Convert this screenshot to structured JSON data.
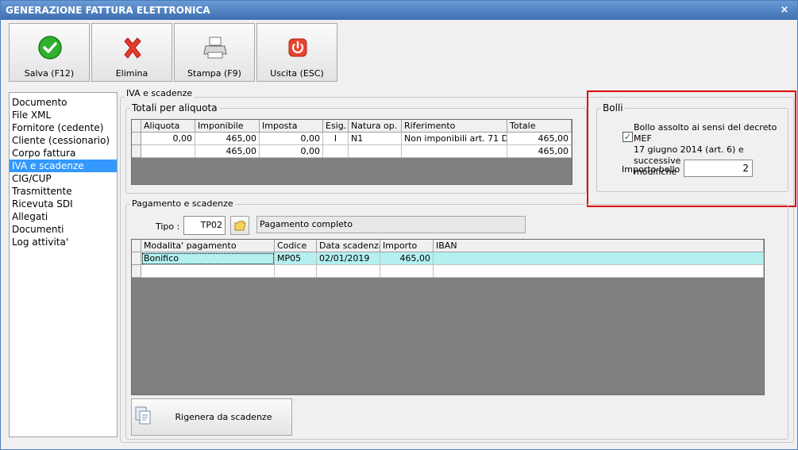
{
  "window": {
    "title": "GENERAZIONE FATTURA ELETTRONICA",
    "close_glyph": "×"
  },
  "toolbar": [
    {
      "label": "Salva (F12)",
      "icon": "check-icon"
    },
    {
      "label": "Elimina",
      "icon": "red-x-icon"
    },
    {
      "label": "Stampa (F9)",
      "icon": "printer-icon"
    },
    {
      "label": "Uscita (ESC)",
      "icon": "power-icon"
    }
  ],
  "nav": [
    "Documento",
    "File XML",
    "Fornitore (cedente)",
    "Cliente (cessionario)",
    "Corpo fattura",
    "IVA e scadenze",
    "CIG/CUP",
    "Trasmittente",
    "Ricevuta SDI",
    "Allegati",
    "Documenti",
    "Log attivita'"
  ],
  "nav_selected": 5,
  "iva": {
    "section_label": "IVA e scadenze",
    "totali_label": "Totali per aliquota",
    "columns": [
      "Aliquota",
      "Imponibile",
      "Imposta",
      "Esig.",
      "Natura op.",
      "Riferimento",
      "Totale"
    ],
    "rows": [
      [
        "0,00",
        "465,00",
        "0,00",
        "I",
        "N1",
        "Non imponibili art. 71 D...",
        "465,00"
      ],
      [
        "",
        "465,00",
        "0,00",
        "",
        "",
        "",
        "465,00"
      ]
    ]
  },
  "bolli": {
    "label": "Bolli",
    "checkbox_checked": true,
    "checkbox_text": [
      "Bollo assolto ai sensi del decreto MEF",
      "17 giugno 2014 (art. 6) e successive",
      "modifiche"
    ],
    "importo_label": "Importo bollo :",
    "importo_value": "2",
    "highlight_color": "#e00000"
  },
  "pagamento": {
    "section_label": "Pagamento e scadenze",
    "tipo_label": "Tipo :",
    "tipo_value": "TP02",
    "tipo_desc": "Pagamento completo",
    "columns": [
      "Modalita' pagamento",
      "Codice",
      "Data scadenza",
      "Importo",
      "IBAN"
    ],
    "rows": [
      [
        "Bonifico",
        "MP05",
        "02/01/2019",
        "465,00",
        ""
      ],
      [
        "",
        "",
        "",
        "",
        ""
      ]
    ],
    "selected_row_color": "#b4f0f0",
    "regen_label": "Rigenera da scadenze"
  }
}
